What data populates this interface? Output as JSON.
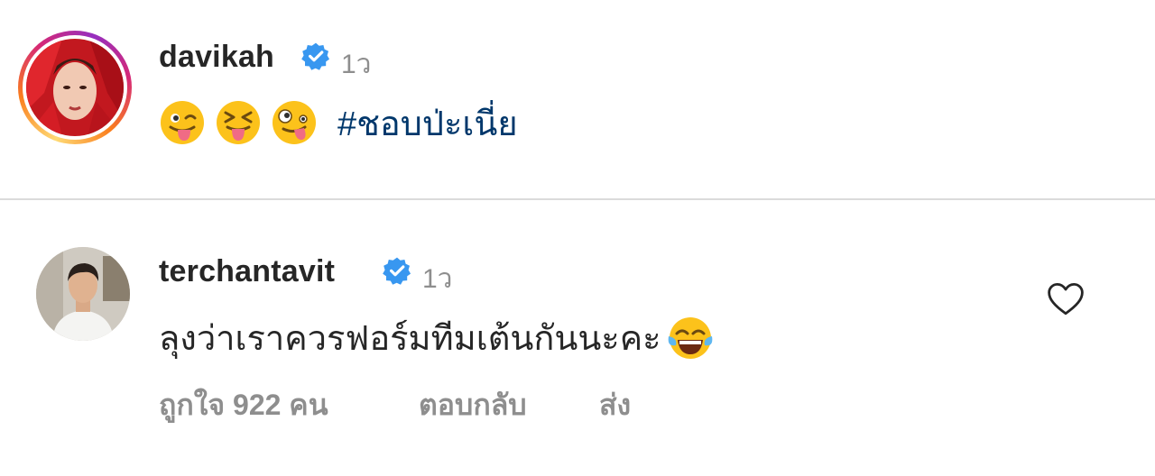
{
  "post": {
    "username": "davikah",
    "time": "1ว",
    "emojis": [
      "winking-tongue-emoji",
      "squinting-tongue-emoji",
      "zany-face-emoji"
    ],
    "hashtag": "#ชอบป่ะเนี่ย"
  },
  "comment": {
    "username": "terchantavit",
    "time": "1ว",
    "text": "ลุงว่าเราควรฟอร์มทีมเต้นกันนะคะ",
    "emoji": "tears-of-joy-emoji",
    "likes": "ถูกใจ 922 คน",
    "reply_label": "ตอบกลับ",
    "send_label": "ส่ง",
    "like_icon": "heart-outline-icon"
  },
  "colors": {
    "verified": "#3897f0",
    "hashtag": "#00376b",
    "muted": "#8e8e8e",
    "text": "#262626",
    "divider": "#dbdbdb"
  }
}
